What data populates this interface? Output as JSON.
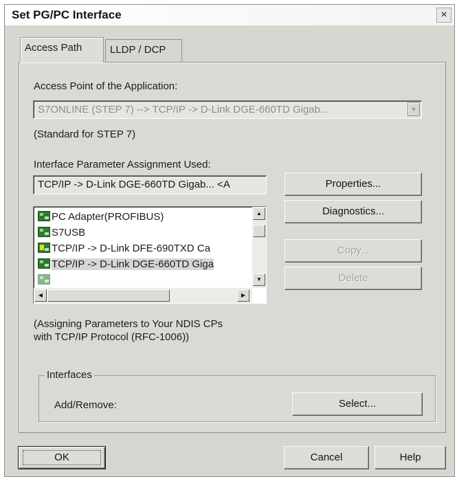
{
  "window": {
    "title": "Set PG/PC Interface",
    "close_glyph": "×"
  },
  "tabs": [
    {
      "label": "Access Path",
      "active": true
    },
    {
      "label": "LLDP / DCP",
      "active": false
    }
  ],
  "access_point": {
    "label": "Access Point of the Application:",
    "value": "S7ONLINE     (STEP 7)     --> TCP/IP -> D-Link DGE-660TD Gigab...",
    "note": "(Standard for STEP 7)"
  },
  "interface_param": {
    "label": "Interface Parameter Assignment Used:",
    "value": "TCP/IP -> D-Link DGE-660TD Gigab...  <A"
  },
  "interface_list": {
    "items": [
      {
        "label": "PC Adapter(PROFIBUS)",
        "icon": "network-adapter-icon",
        "selected": false
      },
      {
        "label": "S7USB",
        "icon": "network-adapter-icon",
        "selected": false
      },
      {
        "label": "TCP/IP -> D-Link DFE-690TXD Ca",
        "icon": "network-adapter-warning-icon",
        "selected": false
      },
      {
        "label": "TCP/IP -> D-Link DGE-660TD Giga",
        "icon": "network-adapter-icon",
        "selected": true
      }
    ]
  },
  "buttons": {
    "properties": "Properties...",
    "diagnostics": "Diagnostics...",
    "copy": "Copy...",
    "delete": "Delete",
    "select": "Select...",
    "ok": "OK",
    "cancel": "Cancel",
    "help": "Help"
  },
  "description": {
    "line1": "(Assigning Parameters to Your NDIS CPs",
    "line2": "with TCP/IP Protocol (RFC-1006))"
  },
  "interfaces_group": {
    "title": "Interfaces",
    "add_remove_label": "Add/Remove:"
  },
  "colors": {
    "dialog_bg": "#d8d6d0",
    "icon_green": "#2f7a2f",
    "disabled_text": "#a3a3a3"
  }
}
